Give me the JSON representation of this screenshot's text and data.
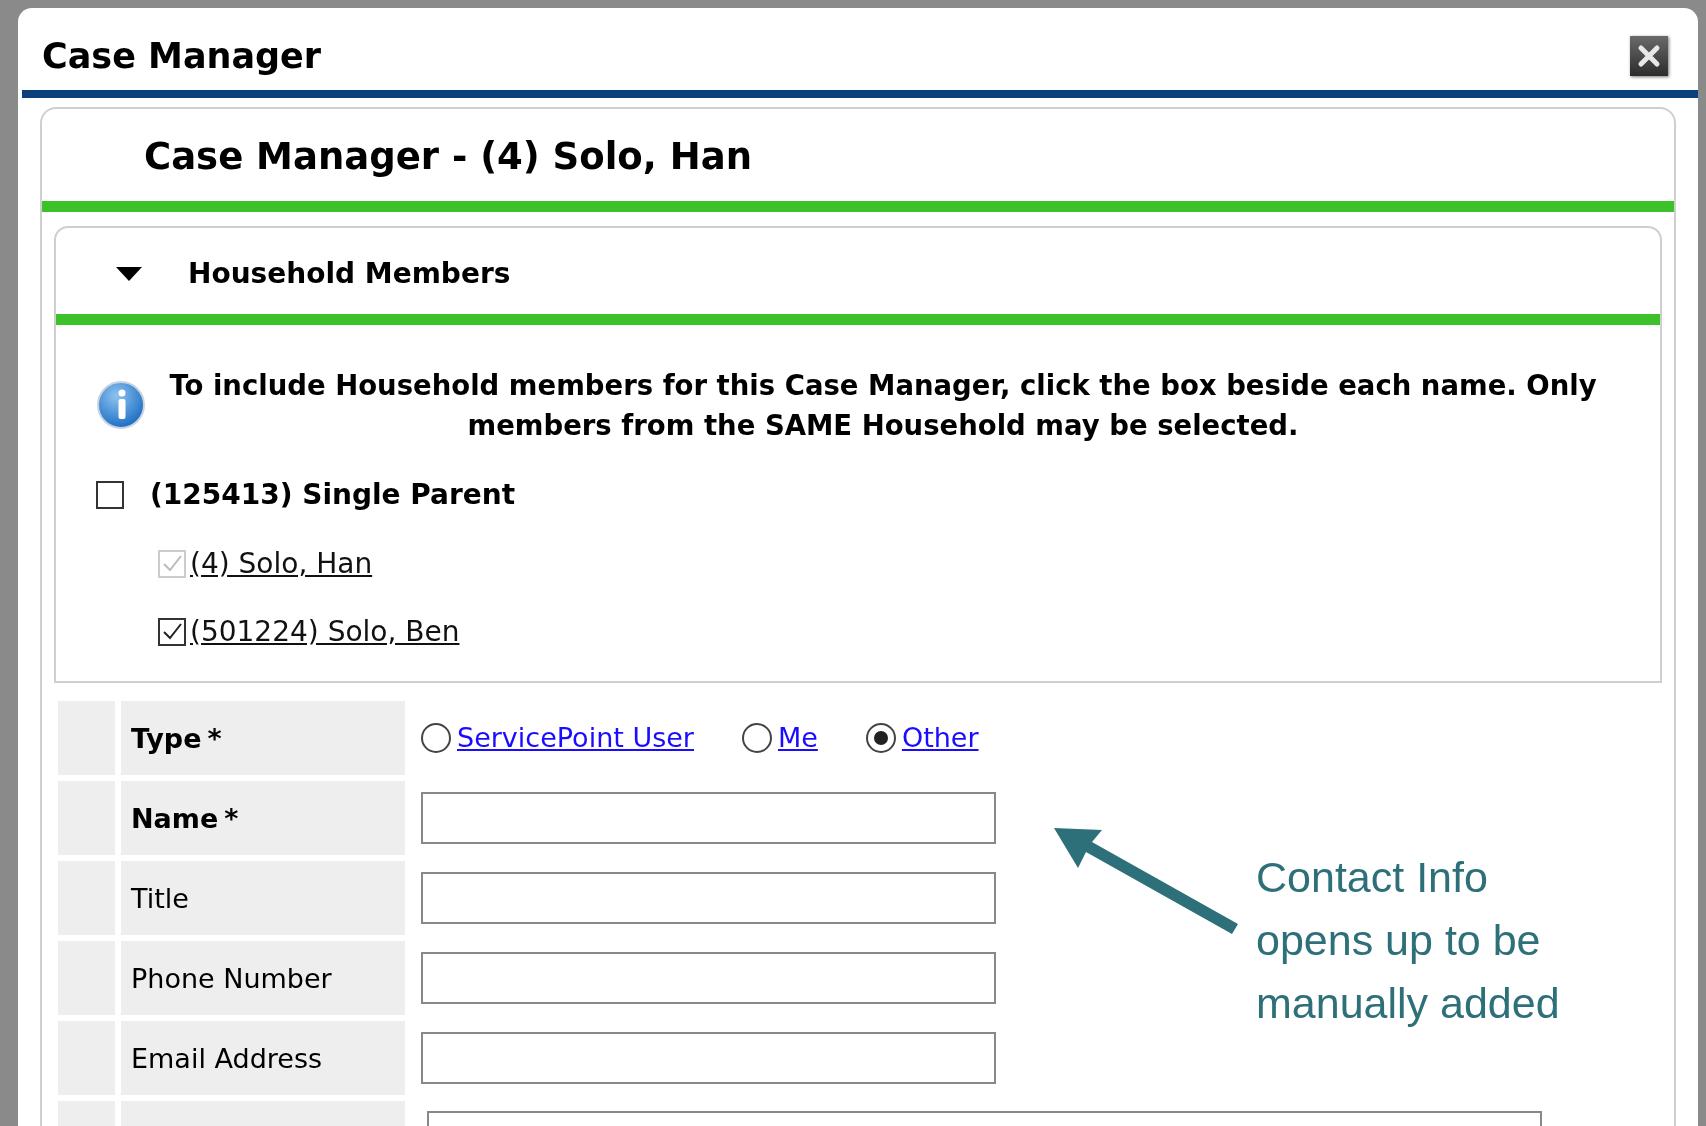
{
  "window": {
    "title": "Case Manager"
  },
  "panel": {
    "title": "Case Manager - (4) Solo, Han"
  },
  "household": {
    "title": "Household Members",
    "expanded": true,
    "info": "To include Household members for this Case Manager, click the box beside each name. Only members from the SAME Household may be selected.",
    "group": {
      "label": "(125413) Single Parent",
      "checked": false
    },
    "members": [
      {
        "label": "(4) Solo, Han",
        "checked": true,
        "disabled": true
      },
      {
        "label": "(501224) Solo, Ben",
        "checked": true,
        "disabled": false
      }
    ]
  },
  "form": {
    "rows": [
      {
        "kind": "radio",
        "label": "Type",
        "required": true,
        "required_mark": "*",
        "options": [
          {
            "label": "ServicePoint User",
            "selected": false
          },
          {
            "label": "Me",
            "selected": false
          },
          {
            "label": "Other",
            "selected": true
          }
        ]
      },
      {
        "kind": "text",
        "label": "Name",
        "required": true,
        "required_mark": "*"
      },
      {
        "kind": "text",
        "label": "Title",
        "required": false
      },
      {
        "kind": "text",
        "label": "Phone Number",
        "required": false
      },
      {
        "kind": "text",
        "label": "Email Address",
        "required": false
      },
      {
        "kind": "wide"
      }
    ]
  },
  "annotation": {
    "text": "Contact Info opens up to be manually added"
  }
}
